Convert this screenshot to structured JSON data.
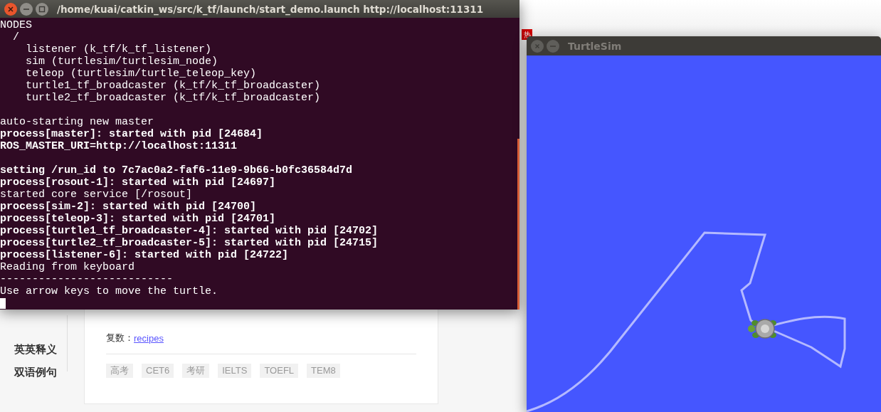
{
  "browser_page": {
    "hot_badge": "热",
    "sidebar": [
      {
        "label": "英英释义"
      },
      {
        "label": "双语例句"
      }
    ],
    "plural_label": "复数：",
    "plural_link": "recipes",
    "tags": [
      "高考",
      "CET6",
      "考研",
      "IELTS",
      "TOEFL",
      "TEM8"
    ]
  },
  "terminal": {
    "title": "/home/kuai/catkin_ws/src/k_tf/launch/start_demo.launch http://localhost:11311",
    "blocks": [
      [
        {
          "text": "NODES",
          "bold": false
        },
        {
          "text": "  /",
          "bold": false
        },
        {
          "text": "    listener (k_tf/k_tf_listener)",
          "bold": false
        },
        {
          "text": "    sim (turtlesim/turtlesim_node)",
          "bold": false
        },
        {
          "text": "    teleop (turtlesim/turtle_teleop_key)",
          "bold": false
        },
        {
          "text": "    turtle1_tf_broadcaster (k_tf/k_tf_broadcaster)",
          "bold": false
        },
        {
          "text": "    turtle2_tf_broadcaster (k_tf/k_tf_broadcaster)",
          "bold": false
        }
      ],
      [
        {
          "text": "auto-starting new master",
          "bold": false
        },
        {
          "text": "process[master]: started with pid [24684]",
          "bold": true
        },
        {
          "text": "ROS_MASTER_URI=http://localhost:11311",
          "bold": true
        }
      ],
      [
        {
          "text": "setting /run_id to 7c7ac0a2-faf6-11e9-9b66-b0fc36584d7d",
          "bold": true
        },
        {
          "text": "process[rosout-1]: started with pid [24697]",
          "bold": true
        },
        {
          "text": "started core service [/rosout]",
          "bold": false
        },
        {
          "text": "process[sim-2]: started with pid [24700]",
          "bold": true
        },
        {
          "text": "process[teleop-3]: started with pid [24701]",
          "bold": true
        },
        {
          "text": "process[turtle1_tf_broadcaster-4]: started with pid [24702]",
          "bold": true
        },
        {
          "text": "process[turtle2_tf_broadcaster-5]: started with pid [24715]",
          "bold": true
        },
        {
          "text": "process[listener-6]: started with pid [24722]",
          "bold": true
        },
        {
          "text": "Reading from keyboard",
          "bold": false
        },
        {
          "text": "---------------------------",
          "bold": false
        },
        {
          "text": "Use arrow keys to move the turtle.",
          "bold": false
        }
      ]
    ]
  },
  "turtlesim": {
    "title": "TurtleSim"
  }
}
